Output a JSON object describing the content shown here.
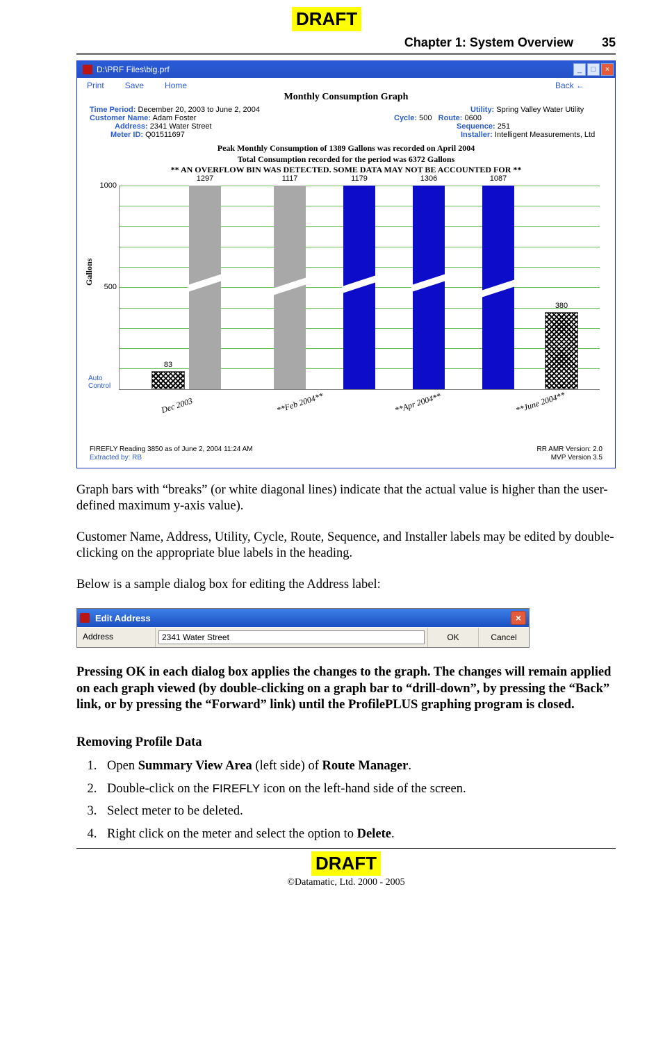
{
  "draft_label": "DRAFT",
  "header": {
    "chapter": "Chapter 1:  System Overview",
    "page": "35"
  },
  "window": {
    "title": "D:\\PRF Files\\big.prf",
    "menus": {
      "print": "Print",
      "save": "Save",
      "home": "Home",
      "back": "Back ←"
    },
    "graph_title": "Monthly Consumption Graph",
    "meta": {
      "time_period_label": "Time Period:",
      "time_period": "December 20, 2003 to June 2, 2004",
      "customer_label": "Customer Name:",
      "customer": "Adam Foster",
      "address_label": "Address:",
      "address": "2341 Water Street",
      "meter_label": "Meter ID:",
      "meter": "Q01511697",
      "utility_label": "Utility:",
      "utility": "Spring Valley Water Utility",
      "cycle_label": "Cycle:",
      "cycle": "500",
      "route_label": "Route:",
      "route": "0600",
      "sequence_label": "Sequence:",
      "sequence": "251",
      "installer_label": "Installer:",
      "installer": "Intelligent Measurements, Ltd"
    },
    "peak": {
      "l1": "Peak Monthly Consumption of 1389 Gallons was recorded on April 2004",
      "l2": "Total Consumption recorded for the period was 6372 Gallons",
      "l3": "** AN OVERFLOW BIN WAS DETECTED.  SOME DATA MAY NOT BE ACCOUNTED FOR **"
    },
    "ylabel": "Gallons",
    "ticks": {
      "t1000": "1000",
      "t500": "500"
    },
    "auto": "Auto\nControl",
    "footer": {
      "left_l1": "FIREFLY Reading 3850 as of June 2, 2004 11:24 AM",
      "left_l2": "Extracted by: RB",
      "right_l1": "RR AMR Version: 2.0",
      "right_l2": "MVP Version 3.5"
    }
  },
  "chart_data": {
    "type": "bar",
    "categories": [
      "Dec 2003",
      "**Feb 2004**",
      "**Apr 2004**",
      "**June 2004**"
    ],
    "series": [
      {
        "name": "hatch",
        "values": [
          83,
          null,
          null,
          380
        ]
      },
      {
        "name": "overflow_a",
        "values": [
          1297,
          1117,
          1179,
          1306
        ],
        "overflow": true
      },
      {
        "name": "overflow_b",
        "values": [
          null,
          null,
          null,
          1087
        ],
        "overflow": true
      }
    ],
    "ylabel": "Gallons",
    "ylim": [
      0,
      1000
    ]
  },
  "para1": "Graph bars with “breaks” (or white diagonal lines) indicate that the actual value is higher than the user-defined maximum y-axis value).",
  "para2": "Customer Name, Address, Utility, Cycle, Route, Sequence, and Installer labels may be edited by double-clicking on the appropriate blue labels in the heading.",
  "para3": "Below is a sample dialog box for editing the Address label:",
  "dialog": {
    "title": "Edit Address",
    "label": "Address",
    "value": "2341 Water Street",
    "ok": "OK",
    "cancel": "Cancel"
  },
  "para4": "Pressing OK in each dialog box applies the changes to the graph.  The changes will remain applied on each graph viewed (by double-clicking on a graph bar to “drill-down”, by pressing the “Back” link, or by pressing the “Forward” link) until the ProfilePLUS graphing program is closed.",
  "section_title": "Removing Profile Data",
  "steps": {
    "s1a": "Open ",
    "s1b": "Summary View Area",
    "s1c": " (left side) of ",
    "s1d": "Route Manager",
    "s1e": ".",
    "s2a": "Double-click on the ",
    "s2b": "FIREFLY",
    "s2c": " icon on the left-hand side of the screen.",
    "s3": "Select meter to be deleted.",
    "s4a": "Right click on the meter and select the option to ",
    "s4b": "Delete",
    "s4c": "."
  },
  "copyright": "©Datamatic, Ltd. 2000 - 2005"
}
